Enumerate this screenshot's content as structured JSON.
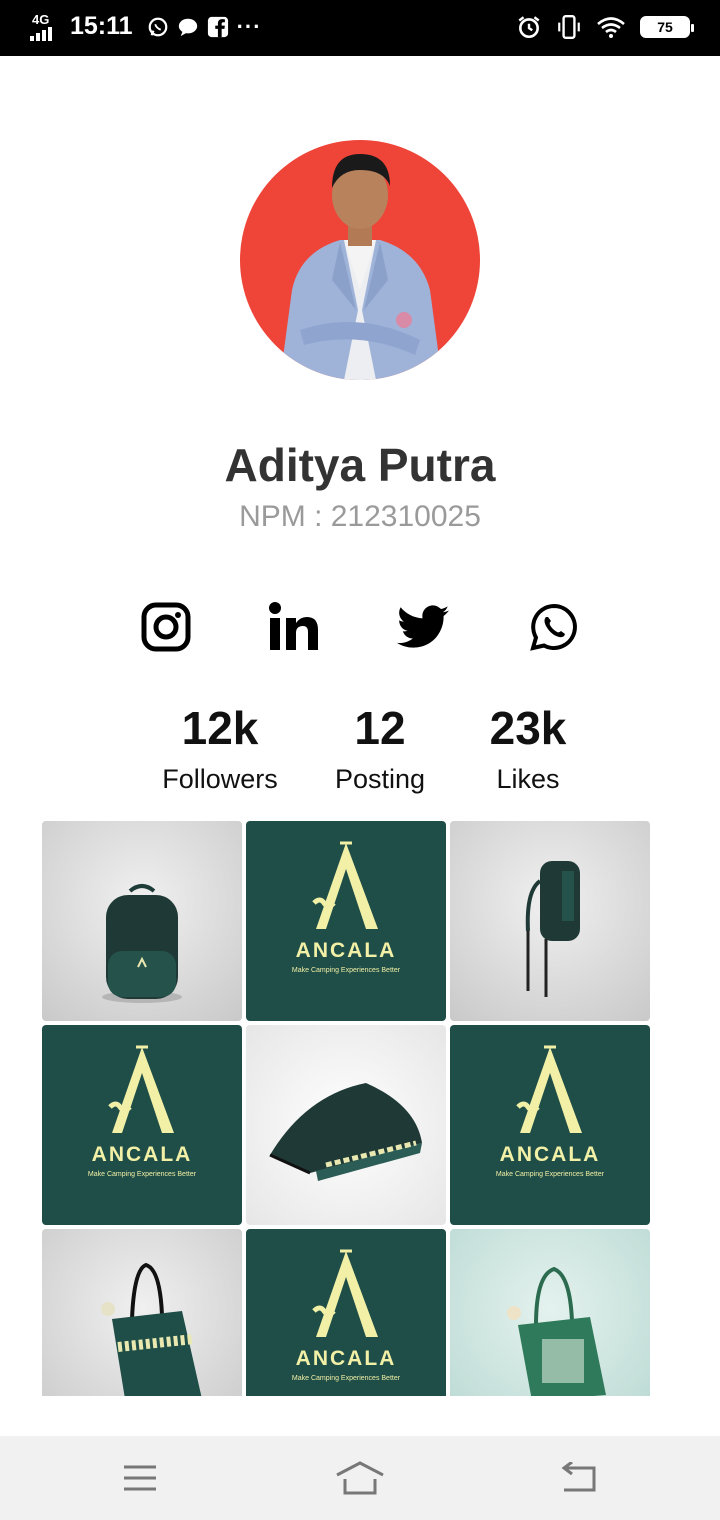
{
  "status_bar": {
    "network": "4G",
    "time": "15:11",
    "more": "···",
    "battery": "75",
    "icons": [
      "whatsapp-icon",
      "chat-bubble-icon",
      "facebook-icon",
      "alarm-icon",
      "vibrate-icon",
      "wifi-icon",
      "battery-icon"
    ]
  },
  "profile": {
    "name": "Aditya Putra",
    "npm": "NPM : 212310025"
  },
  "social": [
    "instagram-icon",
    "linkedin-icon",
    "twitter-icon",
    "whatsapp-icon"
  ],
  "stats": {
    "followers": {
      "value": "12k",
      "label": "Followers"
    },
    "posting": {
      "value": "12",
      "label": "Posting"
    },
    "likes": {
      "value": "23k",
      "label": "Likes"
    }
  },
  "gallery": {
    "logo_word": "ANCALA",
    "logo_tagline": "Make Camping Experiences Better",
    "tiles": [
      "backpack-front",
      "ancala-logo",
      "backpack-side",
      "ancala-logo",
      "tent",
      "ancala-logo",
      "tote-bag-dark",
      "ancala-logo",
      "tote-bag-green"
    ]
  },
  "colors": {
    "brand_green": "#1f4d47",
    "brand_cream": "#f1f0a6",
    "avatar_bg": "#ef4438"
  },
  "nav_bar": [
    "menu-icon",
    "home-icon",
    "back-icon"
  ]
}
